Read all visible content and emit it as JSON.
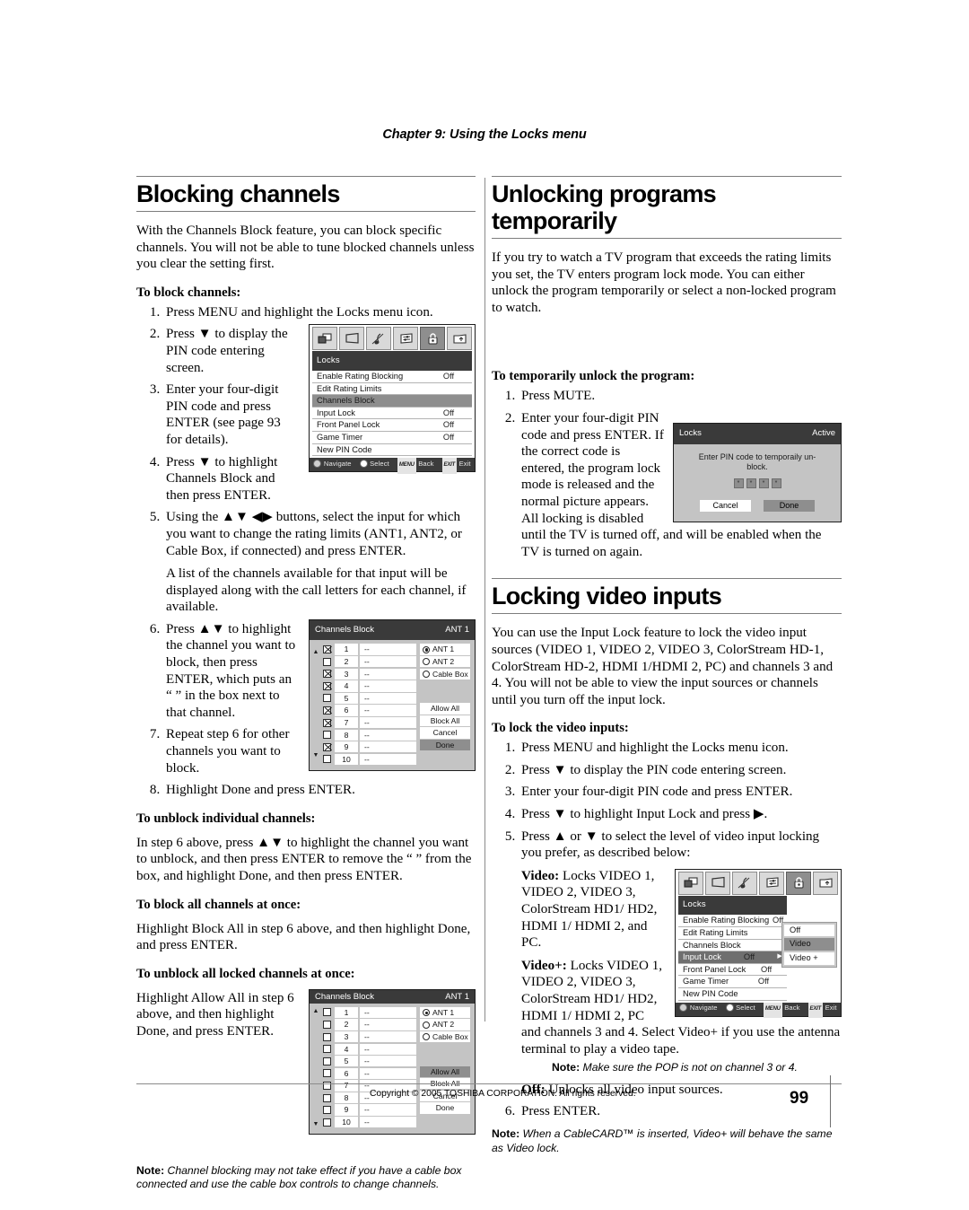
{
  "running_head": "Chapter 9: Using the Locks menu",
  "left_column": {
    "heading": "Blocking channels",
    "intro": "With the Channels Block feature, you can block specific channels. You will not be able to tune blocked channels unless you clear the setting first.",
    "sub_block": "To block channels:",
    "steps": [
      "Press MENU and highlight the Locks menu icon.",
      "Press ▼ to display the PIN code entering screen.",
      "Enter your four-digit PIN code and press ENTER (see page 93 for details).",
      "Press ▼ to highlight Channels Block and then press ENTER.",
      "Using the ▲▼ ◀▶ buttons, select the input for which you want to change the rating limits (ANT1, ANT2, or Cable Box, if connected) and press ENTER.",
      "Press ▲▼ to highlight the channel you want to block, then press ENTER, which puts an “ ” in the box next to that channel.",
      "Repeat step 6 for other channels you want to block.",
      "Highlight Done and press ENTER."
    ],
    "step5_note": "A list of the channels available for that input will be displayed along with the call letters for each channel, if available.",
    "sub_unblock_individual": "To unblock individual channels:",
    "unblock_individual_text": "In step 6 above, press ▲▼ to highlight the channel you want to unblock, and then press ENTER to remove the “ ” from the box, and highlight Done, and then press ENTER.",
    "sub_block_all": "To block all channels at once:",
    "block_all_text": "Highlight Block All in step 6 above, and then highlight Done, and press ENTER.",
    "sub_unblock_all": "To unblock all locked channels at once:",
    "unblock_all_text": "Highlight Allow All in step 6 above, and then highlight Done, and press ENTER.",
    "note_label": "Note:",
    "note_text": "Channel blocking may not take effect if you have a cable box connected and use the cable box controls to change channels."
  },
  "right_column": {
    "heading_unlock": "Unlocking programs temporarily",
    "intro_unlock": "If you try to watch a TV program that exceeds the rating limits you set, the TV enters program lock mode. You can either unlock the program temporarily or select a non-locked program to watch.",
    "sub_temp_unlock": "To temporarily unlock the program:",
    "temp_steps": [
      "Press MUTE.",
      "Enter your four-digit PIN code and press ENTER. If the correct code is entered, the program lock mode is released and the normal picture appears. All locking is disabled until the TV is turned off, and will be enabled when the TV is turned on again."
    ],
    "heading_locking": "Locking video inputs",
    "intro_locking": "You can use the Input Lock feature to lock the video input sources (VIDEO 1, VIDEO 2, VIDEO 3, ColorStream HD-1, ColorStream HD-2, HDMI 1/HDMI 2, PC) and channels 3 and 4. You will not be able to view the input sources or channels until you turn off the input lock.",
    "sub_lock_inputs": "To lock the video inputs:",
    "lock_steps": [
      "Press MENU and highlight the Locks menu icon.",
      "Press ▼ to display the PIN code entering screen.",
      "Enter your four-digit PIN code and press ENTER.",
      "Press ▼ to highlight Input Lock and press ▶.",
      "Press ▲ or ▼ to select the level of video input locking you prefer, as described below:"
    ],
    "video_label": "Video:",
    "video_text": "Locks VIDEO 1, VIDEO 2, VIDEO 3, ColorStream HD1/ HD2, HDMI 1/ HDMI 2, and PC.",
    "videoplus_label": "Video+:",
    "videoplus_text": "Locks VIDEO 1, VIDEO 2, VIDEO 3, ColorStream HD1/ HD2, HDMI 1/ HDMI 2, PC and channels 3 and 4. Select Video+ if you use the antenna terminal to play a video tape.",
    "pop_note_label": "Note:",
    "pop_note_text": "Make sure the POP is not on channel 3 or 4.",
    "off_label": "Off:",
    "off_text": "Unlocks all video input sources.",
    "step6": "Press ENTER.",
    "cablecard_note_label": "Note:",
    "cablecard_note_text": "When a CableCARD™ is inserted, Video+ will behave the same as Video lock."
  },
  "osd_locks_menu": {
    "title": "Locks",
    "icons": [
      "picture-icon",
      "screen-icon",
      "audio-icon",
      "settings-icon",
      "locks-icon",
      "setup-icon"
    ],
    "selected_icon_index": 4,
    "rows": [
      {
        "label": "Enable Rating Blocking",
        "value": "Off",
        "state": "normal"
      },
      {
        "label": "Edit Rating Limits",
        "value": "",
        "state": "normal"
      },
      {
        "label": "Channels Block",
        "value": "",
        "state": "highlight"
      },
      {
        "label": "Input Lock",
        "value": "Off",
        "state": "normal"
      },
      {
        "label": "Front Panel Lock",
        "value": "Off",
        "state": "normal"
      },
      {
        "label": "Game Timer",
        "value": "Off",
        "state": "normal"
      },
      {
        "label": "New PIN Code",
        "value": "",
        "state": "normal"
      }
    ],
    "nav": {
      "navigate": "Navigate",
      "select": "Select",
      "back_key": "MENU",
      "back": "Back",
      "exit_key": "EXIT",
      "exit": "Exit"
    }
  },
  "osd_locks_menu_inputlock": {
    "title": "Locks",
    "selected_icon_index": 4,
    "rows": [
      {
        "label": "Enable Rating Blocking",
        "value": "Off",
        "state": "normal"
      },
      {
        "label": "Edit Rating Limits",
        "value": "",
        "state": "normal"
      },
      {
        "label": "Channels Block",
        "value": "",
        "state": "normal"
      },
      {
        "label": "Input Lock",
        "value": "Off",
        "state": "highlight2",
        "arrow": "▶"
      },
      {
        "label": "Front Panel Lock",
        "value": "Off",
        "state": "normal"
      },
      {
        "label": "Game Timer",
        "value": "Off",
        "state": "normal"
      },
      {
        "label": "New PIN Code",
        "value": "",
        "state": "normal"
      }
    ],
    "submenu": [
      {
        "label": "Off",
        "selected": false
      },
      {
        "label": "Video",
        "selected": true
      },
      {
        "label": "Video +",
        "selected": false
      }
    ],
    "nav": {
      "navigate": "Navigate",
      "select": "Select",
      "back_key": "MENU",
      "back": "Back",
      "exit_key": "EXIT",
      "exit": "Exit"
    }
  },
  "channels_block_blocked": {
    "title": "Channels Block",
    "input": "ANT 1",
    "rows": [
      {
        "num": "1",
        "call": "--",
        "checked": true
      },
      {
        "num": "2",
        "call": "--",
        "checked": false
      },
      {
        "num": "3",
        "call": "--",
        "checked": true
      },
      {
        "num": "4",
        "call": "--",
        "checked": true
      },
      {
        "num": "5",
        "call": "--",
        "checked": false
      },
      {
        "num": "6",
        "call": "--",
        "checked": true
      },
      {
        "num": "7",
        "call": "--",
        "checked": true
      },
      {
        "num": "8",
        "call": "--",
        "checked": false
      },
      {
        "num": "9",
        "call": "--",
        "checked": true
      },
      {
        "num": "10",
        "call": "--",
        "checked": false
      }
    ],
    "inputs": [
      {
        "label": "ANT 1",
        "selected": true
      },
      {
        "label": "ANT 2",
        "selected": false
      },
      {
        "label": "Cable Box",
        "selected": false
      }
    ],
    "buttons": [
      {
        "label": "Allow All",
        "highlighted": false
      },
      {
        "label": "Block All",
        "highlighted": false
      },
      {
        "label": "Cancel",
        "highlighted": false
      },
      {
        "label": "Done",
        "highlighted": true
      }
    ]
  },
  "channels_block_allowed": {
    "title": "Channels Block",
    "input": "ANT 1",
    "rows": [
      {
        "num": "1",
        "call": "--",
        "checked": false
      },
      {
        "num": "2",
        "call": "--",
        "checked": false
      },
      {
        "num": "3",
        "call": "--",
        "checked": false
      },
      {
        "num": "4",
        "call": "--",
        "checked": false
      },
      {
        "num": "5",
        "call": "--",
        "checked": false
      },
      {
        "num": "6",
        "call": "--",
        "checked": false
      },
      {
        "num": "7",
        "call": "--",
        "checked": false
      },
      {
        "num": "8",
        "call": "--",
        "checked": false
      },
      {
        "num": "9",
        "call": "--",
        "checked": false
      },
      {
        "num": "10",
        "call": "--",
        "checked": false
      }
    ],
    "inputs": [
      {
        "label": "ANT 1",
        "selected": true
      },
      {
        "label": "ANT 2",
        "selected": false
      },
      {
        "label": "Cable Box",
        "selected": false
      }
    ],
    "buttons": [
      {
        "label": "Allow All",
        "highlighted": true
      },
      {
        "label": "Block All",
        "highlighted": false
      },
      {
        "label": "Cancel",
        "highlighted": false
      },
      {
        "label": "Done",
        "highlighted": false
      }
    ]
  },
  "pin_dialog": {
    "title": "Locks",
    "status": "Active",
    "message": "Enter PIN code to temporaily un-block.",
    "digits": [
      "*",
      "*",
      "*",
      "*"
    ],
    "cancel": "Cancel",
    "done": "Done"
  },
  "footer": {
    "copyright": "Copyright © 2005 TOSHIBA CORPORATION. All rights reserved.",
    "page_number": "99"
  }
}
